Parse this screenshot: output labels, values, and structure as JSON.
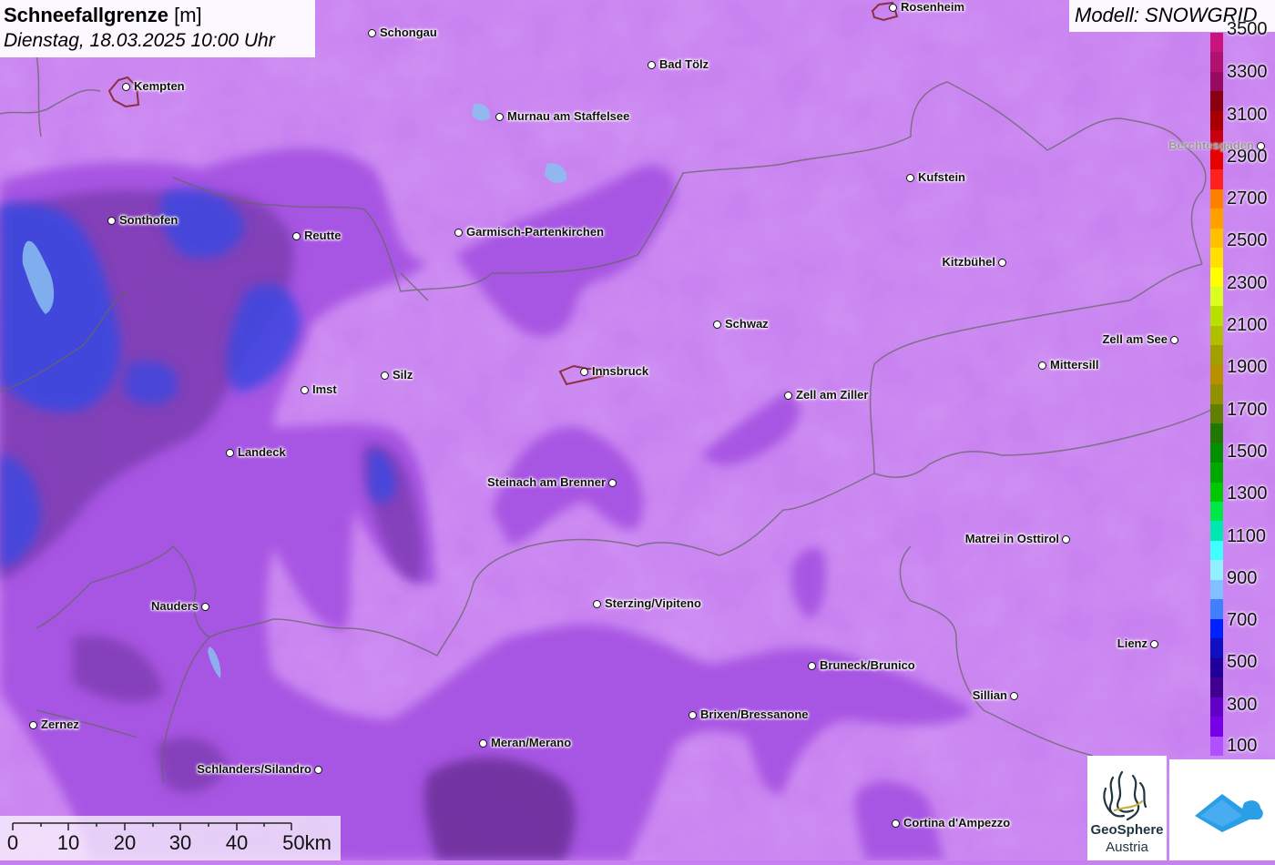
{
  "title": {
    "main": "Schneefallgrenze",
    "unit": "[m]",
    "datetime": "Dienstag, 18.03.2025 10:00 Uhr"
  },
  "model_label": "Modell: SNOWGRID",
  "legend": {
    "labels": [
      "3500",
      "3300",
      "3100",
      "2900",
      "2700",
      "2500",
      "2300",
      "2100",
      "1900",
      "1700",
      "1500",
      "1300",
      "1100",
      "900",
      "700",
      "500",
      "300",
      "100"
    ],
    "colors": [
      "#c8147c",
      "#b0106e",
      "#980a60",
      "#8a0010",
      "#a80000",
      "#c80010",
      "#e60000",
      "#ff2020",
      "#ff7f00",
      "#ff9f00",
      "#ffc000",
      "#ffe000",
      "#ffff00",
      "#d8ff20",
      "#b8e000",
      "#b0c000",
      "#a0a000",
      "#b89000",
      "#909000",
      "#608000",
      "#207800",
      "#009000",
      "#00a800",
      "#00c800",
      "#00e848",
      "#00e8b0",
      "#40ffff",
      "#90f0ff",
      "#80c0ff",
      "#4080ff",
      "#0020ff",
      "#1010c0",
      "#200098",
      "#400090",
      "#6000c8",
      "#7800e8",
      "#b050ff"
    ]
  },
  "scale": {
    "labels": [
      "0",
      "10",
      "20",
      "30",
      "40",
      "50km"
    ]
  },
  "logos": {
    "geosphere_line1": "GeoSphere",
    "geosphere_line2": "Austria"
  },
  "cities": [
    {
      "name": "Rosenheim",
      "side": "right"
    },
    {
      "name": "Schongau",
      "side": "right"
    },
    {
      "name": "Kempten",
      "side": "right"
    },
    {
      "name": "Bad Tölz",
      "side": "right"
    },
    {
      "name": "Murnau am Staffelsee",
      "side": "right"
    },
    {
      "name": "Berchtesgaden",
      "side": "left"
    },
    {
      "name": "Kufstein",
      "side": "right"
    },
    {
      "name": "Sonthofen",
      "side": "right"
    },
    {
      "name": "Reutte",
      "side": "right"
    },
    {
      "name": "Garmisch-Partenkirchen",
      "side": "right"
    },
    {
      "name": "Kitzbühel",
      "side": "left"
    },
    {
      "name": "Schwaz",
      "side": "right"
    },
    {
      "name": "Zell am See",
      "side": "left"
    },
    {
      "name": "Mittersill",
      "side": "right"
    },
    {
      "name": "Silz",
      "side": "right"
    },
    {
      "name": "Innsbruck",
      "side": "right"
    },
    {
      "name": "Imst",
      "side": "right"
    },
    {
      "name": "Zell am Ziller",
      "side": "right"
    },
    {
      "name": "Landeck",
      "side": "right"
    },
    {
      "name": "Steinach am Brenner",
      "side": "left"
    },
    {
      "name": "Matrei in Osttirol",
      "side": "left"
    },
    {
      "name": "Nauders",
      "side": "left"
    },
    {
      "name": "Sterzing/Vipiteno",
      "side": "right"
    },
    {
      "name": "Lienz",
      "side": "left"
    },
    {
      "name": "Bruneck/Brunico",
      "side": "right"
    },
    {
      "name": "Sillian",
      "side": "left"
    },
    {
      "name": "Brixen/Bressanone",
      "side": "right"
    },
    {
      "name": "Zernez",
      "side": "right"
    },
    {
      "name": "Meran/Merano",
      "side": "right"
    },
    {
      "name": "Schlanders/Silandro",
      "side": "left"
    },
    {
      "name": "Cortina d'Ampezzo",
      "side": "right"
    }
  ]
}
